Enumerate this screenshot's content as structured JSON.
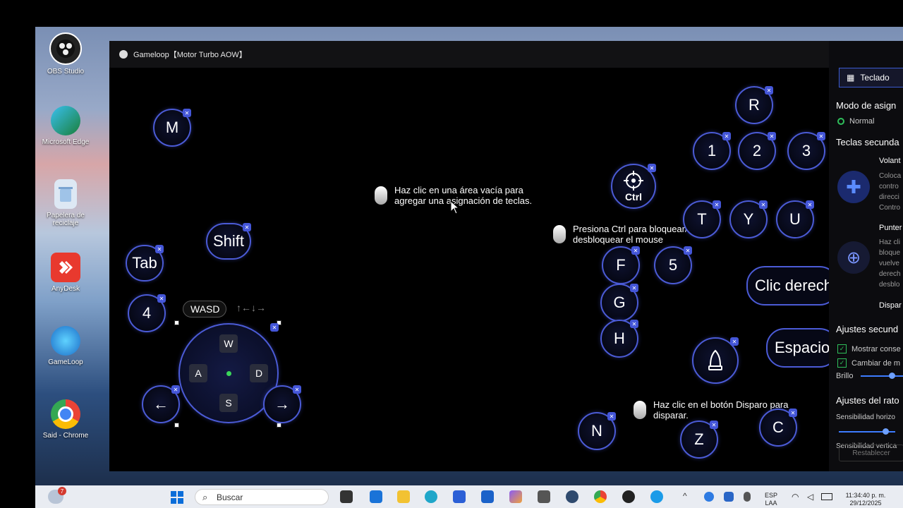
{
  "desktop": {
    "icons": [
      {
        "label": "OBS Studio"
      },
      {
        "label": "Microsoft Edge"
      },
      {
        "label": "Papelera de reciclaje"
      },
      {
        "label": "AnyDesk"
      },
      {
        "label": "GameLoop"
      },
      {
        "label": "Said - Chrome"
      }
    ]
  },
  "window": {
    "title": "Gameloop【Motor Turbo AOW】"
  },
  "canvas": {
    "keys": {
      "m": "M",
      "r": "R",
      "one": "1",
      "two": "2",
      "three": "3",
      "ctrl": "Ctrl",
      "t": "T",
      "y": "Y",
      "u": "U",
      "shift": "Shift",
      "tab": "Tab",
      "four": "4",
      "f": "F",
      "five": "5",
      "g": "G",
      "h": "H",
      "n": "N",
      "z": "Z",
      "c": "C",
      "left_arrow": "←",
      "right_arrow": "→",
      "w": "W",
      "a": "A",
      "s": "S",
      "d": "D"
    },
    "wasd_label": "WASD",
    "wasd_arrows": "↑←↓→",
    "right_click": "Clic derech",
    "space": "Espacio",
    "tip_empty_area": "Haz clic en una área vacía para agregar una asignación de teclas.",
    "tip_ctrl": "Presiona Ctrl para bloquear/ desbloquear el mouse",
    "tip_fire": "Haz clic en el botón Disparo para disparar."
  },
  "panel": {
    "tab_label": "Teclado",
    "mode_title": "Modo de asign",
    "mode_normal": "Normal",
    "secondary_title": "Teclas secunda",
    "volante_title": "Volant",
    "volante_desc": [
      "Coloca",
      "contro",
      "direcci",
      "Contro"
    ],
    "puntero_title": "Punter",
    "puntero_desc": [
      "Haz cli",
      "bloque",
      "vuelve",
      "derech",
      "desblo"
    ],
    "disparo_title": "Dispar",
    "ajustes_sec_title": "Ajustes secund",
    "check_show": "Mostrar conse",
    "check_change": "Cambiar de m",
    "brillo": "Brillo",
    "mouse_title": "Ajustes del rato",
    "sens_h": "Sensibilidad horizo",
    "sens_v": "Sensibilidad vertica",
    "reset": "Restablecer"
  },
  "taskbar": {
    "search_placeholder": "Buscar",
    "lang": "ESP",
    "lang_sub": "LAA",
    "time": "11:34:40 p. m.",
    "date": "29/12/2025",
    "notification_count": "7"
  }
}
